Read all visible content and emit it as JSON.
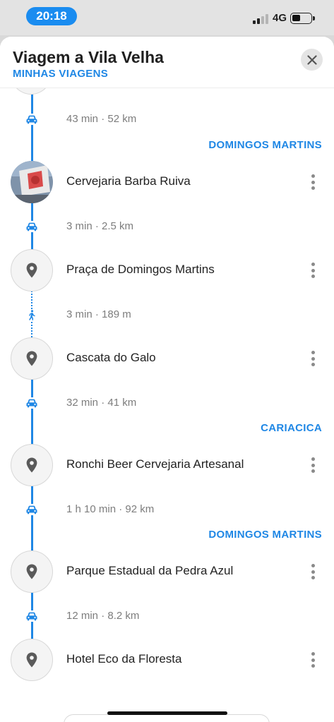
{
  "status_bar": {
    "time": "20:18",
    "network": "4G"
  },
  "header": {
    "title": "Viagem a Vila Velha",
    "subtitle": "MINHAS VIAGENS"
  },
  "legs": [
    {
      "mode": "car",
      "info": "43 min · 52 km"
    },
    {
      "mode": "car",
      "info": "3 min · 2.5 km"
    },
    {
      "mode": "walk",
      "info": "3 min · 189 m"
    },
    {
      "mode": "car",
      "info": "32 min · 41 km"
    },
    {
      "mode": "car",
      "info": "1 h 10 min · 92 km"
    },
    {
      "mode": "car",
      "info": "12 min · 8.2 km"
    }
  ],
  "regions": [
    "DOMINGOS MARTINS",
    "CARIACICA",
    "DOMINGOS MARTINS"
  ],
  "stops": [
    {
      "name": "Cervejaria Barba Ruiva",
      "icon": "photo-thumbnail"
    },
    {
      "name": "Praça de Domingos Martins",
      "icon": "map-pin-icon"
    },
    {
      "name": "Cascata do Galo",
      "icon": "map-pin-icon"
    },
    {
      "name": "Ronchi Beer Cervejaria Artesanal",
      "icon": "map-pin-icon"
    },
    {
      "name": "Parque Estadual da Pedra Azul",
      "icon": "map-pin-icon"
    },
    {
      "name": "Hotel Eco da Floresta",
      "icon": "map-pin-icon"
    }
  ],
  "colors": {
    "accent": "#1f87e5",
    "time_pill": "#1a8cf0"
  }
}
